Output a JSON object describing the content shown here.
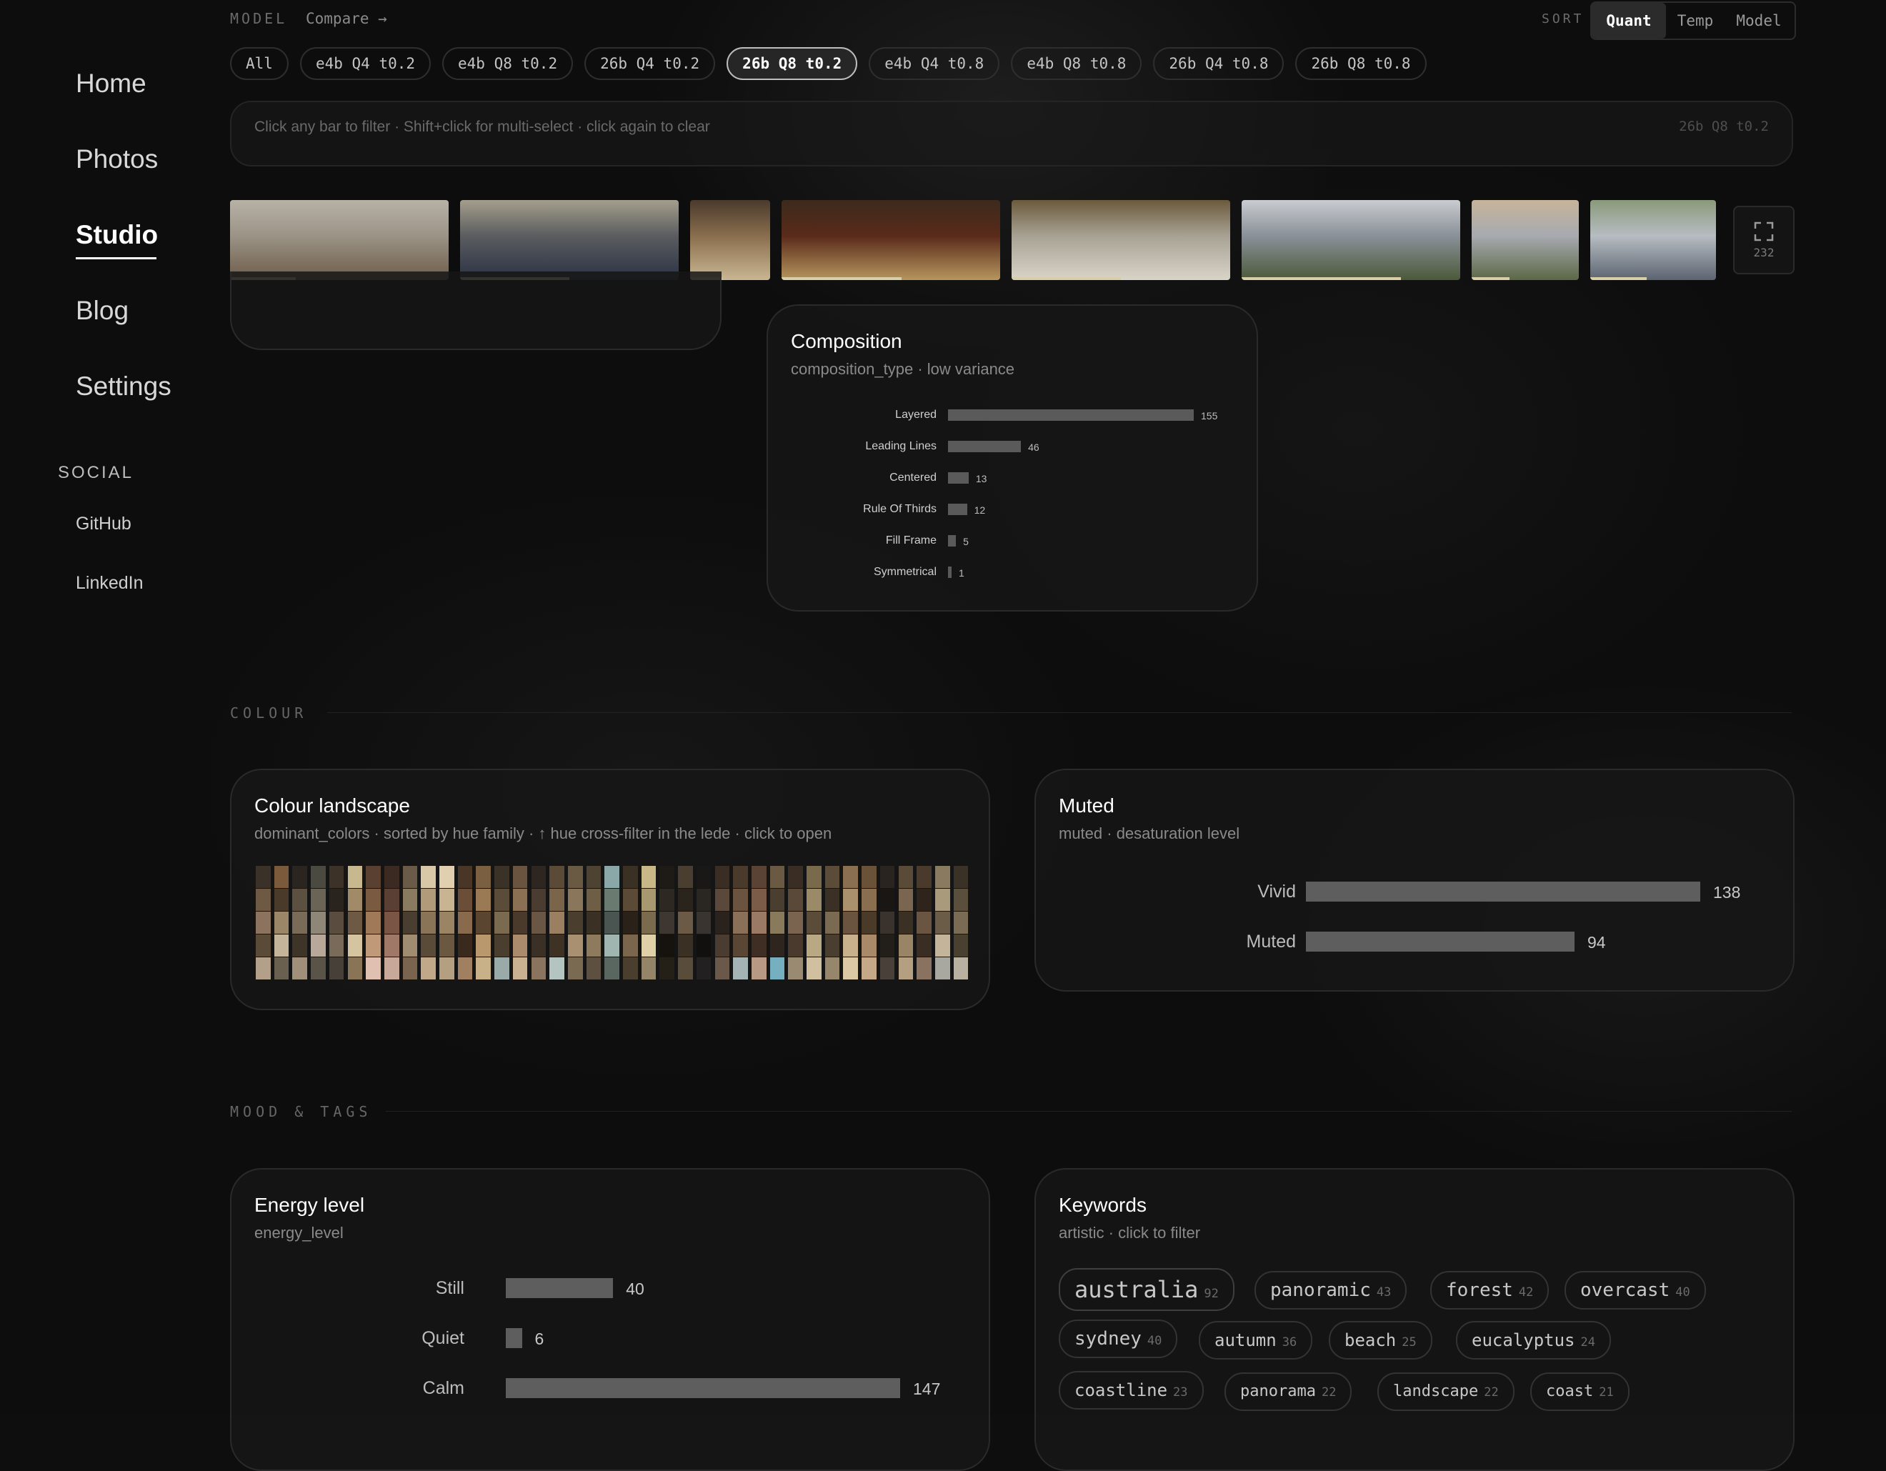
{
  "sidebar": {
    "nav": [
      "Home",
      "Photos",
      "Studio",
      "Blog",
      "Settings"
    ],
    "active": "Studio",
    "social_heading": "SOCIAL",
    "social_links": [
      "GitHub",
      "LinkedIn"
    ]
  },
  "topbar": {
    "model_label": "MODEL",
    "compare_label": "Compare →",
    "sort_label": "SORT",
    "sort_options": [
      "Quant",
      "Temp",
      "Model"
    ],
    "sort_active": "Quant"
  },
  "chips": [
    "All",
    "e4b Q4 t0.2",
    "e4b Q8 t0.2",
    "26b Q4 t0.2",
    "26b Q8 t0.2",
    "e4b Q4 t0.8",
    "e4b Q8 t0.8",
    "26b Q4 t0.8",
    "26b Q8 t0.8"
  ],
  "active_chip": "26b Q8 t0.2",
  "hint": {
    "text": "Click any bar to filter · Shift+click for multi-select · click again to clear",
    "current_model": "26b Q8 t0.2"
  },
  "photo_strip": {
    "count": "232",
    "expand_icon": "expand-icon",
    "thumbs": [
      {
        "name": "thumb-ibis",
        "colors": [
          "#9a9386",
          "#6f5c4a",
          "#b8b2a6"
        ],
        "progress": 0.3
      },
      {
        "name": "thumb-parade",
        "colors": [
          "#5a5c5f",
          "#2b3244",
          "#a49e8c"
        ],
        "progress": 0.5
      },
      {
        "name": "thumb-corridor",
        "colors": [
          "#8a6e4e",
          "#c9b692",
          "#4a3a2c"
        ],
        "progress": 0.4
      },
      {
        "name": "thumb-painting",
        "colors": [
          "#5a2a1a",
          "#b6965e",
          "#3c2a1c"
        ],
        "progress": 0.55
      },
      {
        "name": "thumb-fountain",
        "colors": [
          "#a8a294",
          "#d9d4c8",
          "#6b5a3c"
        ],
        "progress": 0.5
      },
      {
        "name": "thumb-city-river",
        "colors": [
          "#8a9098",
          "#4b5a3a",
          "#c9ccd0"
        ],
        "progress": 0.73
      },
      {
        "name": "thumb-parklands",
        "colors": [
          "#a7aab0",
          "#5c6846",
          "#c7b49a"
        ],
        "progress": 0.35
      },
      {
        "name": "thumb-skyline",
        "colors": [
          "#b7bcc2",
          "#5b6470",
          "#8a9a7a"
        ],
        "progress": 0.45
      }
    ]
  },
  "composition": {
    "title": "Composition",
    "subtitle": "composition_type · low variance"
  },
  "colour_section": "COLOUR",
  "colour_landscape": {
    "title": "Colour landscape",
    "subtitle": "dominant_colors · sorted by hue family · ↑ hue cross-filter in the lede · click to open"
  },
  "muted": {
    "title": "Muted",
    "subtitle": "muted · desaturation level"
  },
  "mood_section": "MOOD & TAGS",
  "energy": {
    "title": "Energy level",
    "subtitle": "energy_level"
  },
  "keywords": {
    "title": "Keywords",
    "subtitle": "artistic · click to filter",
    "items": [
      {
        "word": "australia",
        "count": "92"
      },
      {
        "word": "panoramic",
        "count": "43"
      },
      {
        "word": "forest",
        "count": "42"
      },
      {
        "word": "overcast",
        "count": "40"
      },
      {
        "word": "sydney",
        "count": "40"
      },
      {
        "word": "autumn",
        "count": "36"
      },
      {
        "word": "beach",
        "count": "25"
      },
      {
        "word": "eucalyptus",
        "count": "24"
      },
      {
        "word": "coastline",
        "count": "23"
      },
      {
        "word": "panorama",
        "count": "22"
      },
      {
        "word": "landscape",
        "count": "22"
      },
      {
        "word": "coast",
        "count": "21"
      }
    ]
  },
  "chart_data": [
    {
      "type": "bar",
      "title": "Composition",
      "categories": [
        "Layered",
        "Leading Lines",
        "Centered",
        "Rule Of Thirds",
        "Fill Frame",
        "Symmetrical"
      ],
      "values": [
        155,
        46,
        13,
        12,
        5,
        1
      ]
    },
    {
      "type": "bar",
      "title": "Muted",
      "categories": [
        "Vivid",
        "Muted"
      ],
      "values": [
        138,
        94
      ]
    },
    {
      "type": "bar",
      "title": "Energy level",
      "categories": [
        "Still",
        "Quiet",
        "Calm"
      ],
      "values": [
        40,
        6,
        147
      ]
    },
    {
      "type": "heatmap",
      "title": "Colour landscape",
      "palette_columns": [
        [
          "#3a3228",
          "#6e5a44",
          "#8b7360",
          "#5a4a38",
          "#b2a08a"
        ],
        [
          "#7a5a3a",
          "#4a3a2a",
          "#9c8668",
          "#c4b49a",
          "#6a6050"
        ],
        [
          "#2a2520",
          "#5c5040",
          "#7a6a58",
          "#3e3428",
          "#a0907a"
        ],
        [
          "#4a4a40",
          "#6a6456",
          "#8e8676",
          "#b8a89a",
          "#5a5448"
        ],
        [
          "#3c3228",
          "#2a241e",
          "#5a4c3e",
          "#7a6a5a",
          "#464038"
        ],
        [
          "#c8b890",
          "#a08a68",
          "#6e5a44",
          "#d4c4a0",
          "#8a7458"
        ],
        [
          "#5a4030",
          "#7a5a40",
          "#a07a58",
          "#c09a78",
          "#e0c0b0"
        ],
        [
          "#3a2a22",
          "#5a4034",
          "#7a5444",
          "#a07868",
          "#c8a898"
        ],
        [
          "#6a5a48",
          "#8a7a60",
          "#4a3e30",
          "#a08c70",
          "#7a6450"
        ],
        [
          "#d8c8a8",
          "#b09a7a",
          "#8a7458",
          "#5a4a38",
          "#c0a888"
        ],
        [
          "#e0d0b0",
          "#c8b490",
          "#9a8464",
          "#6a5840",
          "#b4a080"
        ],
        [
          "#4a3626",
          "#6a4e38",
          "#8a6a4c",
          "#3a2a1e",
          "#a08060"
        ],
        [
          "#7a6040",
          "#9a7a54",
          "#5a4630",
          "#b8986c",
          "#c8b088"
        ],
        [
          "#3a3226",
          "#5a4c38",
          "#7a6a50",
          "#4a3e2e",
          "#9aaaa8"
        ],
        [
          "#6a5440",
          "#8c7054",
          "#4a3a2c",
          "#aa8c6c",
          "#c8b090"
        ],
        [
          "#2e2620",
          "#4a3c30",
          "#6a5644",
          "#3a3026",
          "#8a7460"
        ],
        [
          "#5a4a36",
          "#7a644a",
          "#9a8060",
          "#3e3224",
          "#b4c4c0"
        ],
        [
          "#6a5a44",
          "#8a765a",
          "#4a3e2e",
          "#a89070",
          "#7a6a52"
        ],
        [
          "#4e4232",
          "#6e5e46",
          "#3a3024",
          "#8e7a5c",
          "#5e5040"
        ],
        [
          "#8aa8a8",
          "#6a7a70",
          "#4a5450",
          "#a0b4b0",
          "#5a6660"
        ],
        [
          "#3a3024",
          "#5a4a36",
          "#2a2218",
          "#7a664c",
          "#4a3e2e"
        ],
        [
          "#c8b888",
          "#a89870",
          "#7a6a4e",
          "#e0d0a8",
          "#948468"
        ],
        [
          "#1e1a16",
          "#2e2822",
          "#3e3630",
          "#16120e",
          "#242018"
        ],
        [
          "#4a3e30",
          "#2a241c",
          "#6a5a46",
          "#3a3024",
          "#5a4c3a"
        ],
        [
          "#1a1816",
          "#2a2622",
          "#3a3430",
          "#12100e",
          "#222020"
        ],
        [
          "#3a2e24",
          "#5a483a",
          "#2a221c",
          "#4a3c30",
          "#6a584a"
        ],
        [
          "#4a3a2c",
          "#6a5440",
          "#8a7058",
          "#5a4634",
          "#a4b4b4"
        ],
        [
          "#5a4234",
          "#7a5c48",
          "#9a7a64",
          "#3e2e24",
          "#b89a84"
        ],
        [
          "#6a5a44",
          "#4a3e30",
          "#8a7a5c",
          "#2e261e",
          "#76b0c0"
        ],
        [
          "#3a2e24",
          "#5a4838",
          "#7a6450",
          "#4a3a2e",
          "#9a8a72"
        ],
        [
          "#7a6a4c",
          "#9a8a68",
          "#5a4c38",
          "#b8a884",
          "#d0c0a0"
        ],
        [
          "#5a4c38",
          "#3a3026",
          "#7a6a52",
          "#4a3e30",
          "#96866c"
        ],
        [
          "#8a7050",
          "#aa906c",
          "#6a5440",
          "#c8b08c",
          "#dcc8a4"
        ],
        [
          "#6a5238",
          "#8a6e50",
          "#4a3a28",
          "#a88a68",
          "#c4a888"
        ],
        [
          "#2a2420",
          "#1a1614",
          "#3a322c",
          "#221e1a",
          "#4a403a"
        ],
        [
          "#5a4a38",
          "#7a6650",
          "#3a3024",
          "#9a8466",
          "#b4a080"
        ],
        [
          "#4a3a2c",
          "#2e241c",
          "#6a5442",
          "#3a2e24",
          "#8a7260"
        ],
        [
          "#8a7a60",
          "#aa9a7c",
          "#6a5c46",
          "#c4b49a",
          "#a8a8a0"
        ],
        [
          "#3a3226",
          "#5a4e3c",
          "#7a6c54",
          "#4a4030",
          "#b8b0a0"
        ]
      ]
    }
  ]
}
